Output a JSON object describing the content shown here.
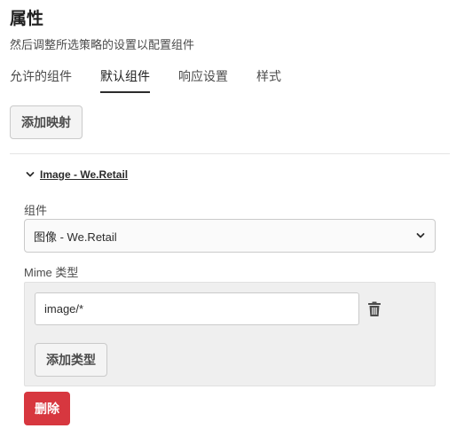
{
  "header": {
    "title": "属性",
    "subtitle": "然后调整所选策略的设置以配置组件"
  },
  "tabs": [
    {
      "label": "允许的组件",
      "active": false
    },
    {
      "label": "默认组件",
      "active": true
    },
    {
      "label": "响应设置",
      "active": false
    },
    {
      "label": "样式",
      "active": false
    }
  ],
  "toolbar": {
    "add_mapping_label": "添加映射"
  },
  "mapping": {
    "title": "Image - We.Retail",
    "component_label": "组件",
    "component_value": "图像 - We.Retail",
    "mime_label": "Mime 类型",
    "mime_value": "image/*",
    "add_type_label": "添加类型",
    "delete_label": "删除"
  },
  "colors": {
    "danger": "#d7373f",
    "active_tab_indicator": "#2c2c2c"
  },
  "icons": {
    "collapse": "chevron-down-icon",
    "select": "chevron-down-icon",
    "remove": "trash-icon"
  }
}
